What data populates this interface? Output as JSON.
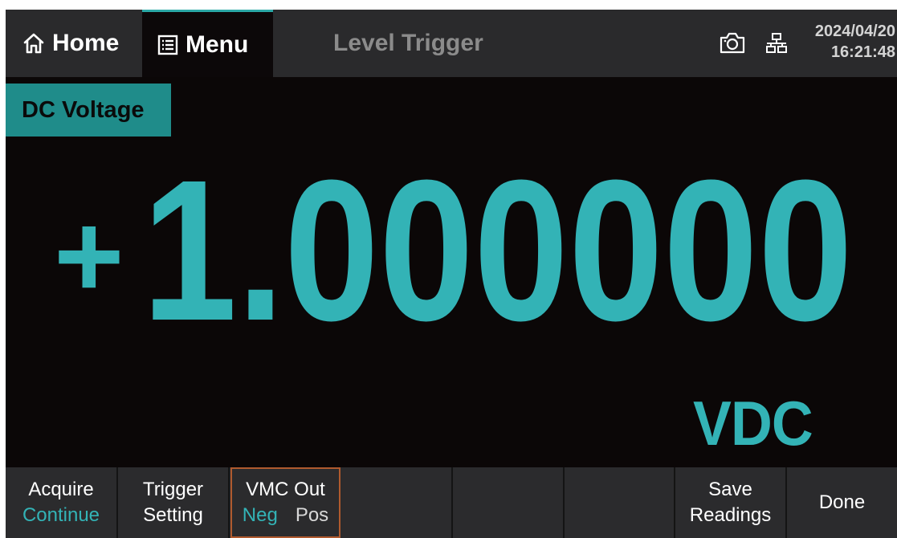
{
  "topbar": {
    "home_label": "Home",
    "menu_label": "Menu",
    "title": "Level Trigger",
    "date": "2024/04/20",
    "time": "16:21:48"
  },
  "measurement": {
    "function_label": "DC Voltage",
    "sign": "+",
    "value": "1.000000",
    "unit": "VDC",
    "reading_color": "#33b3b6"
  },
  "softkeys": [
    {
      "line1": "Acquire",
      "line2": "Continue"
    },
    {
      "line1": "Trigger",
      "line2": "Setting"
    },
    {
      "line1": "VMC Out",
      "options": [
        "Neg",
        "Pos"
      ],
      "selected": "Neg"
    },
    {
      "line1": ""
    },
    {
      "line1": ""
    },
    {
      "line1": ""
    },
    {
      "line1": "Save",
      "line2": "Readings"
    },
    {
      "line1": "Done"
    }
  ],
  "colors": {
    "accent": "#33b3b6",
    "function_bg": "#1f8c8a",
    "background": "#0b0707",
    "bar": "#2b2b2d",
    "selected_border": "#b05a2e"
  },
  "icons": [
    "home-icon",
    "menu-list-icon",
    "camera-icon",
    "network-icon"
  ]
}
